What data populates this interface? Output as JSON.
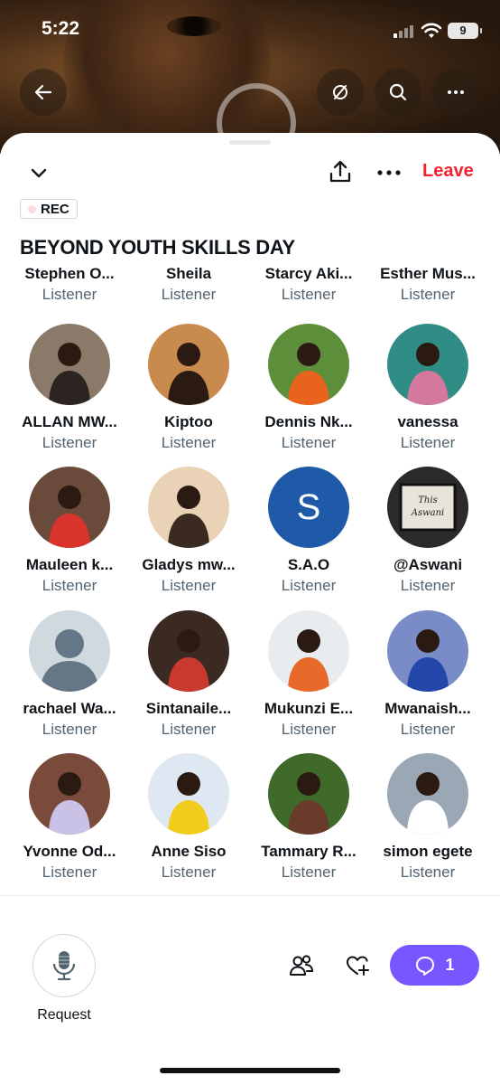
{
  "status_bar": {
    "time": "5:22",
    "battery": "9"
  },
  "sheet": {
    "leave_label": "Leave",
    "rec_label": "REC",
    "space_title": "BEYOND YOUTH SKILLS DAY"
  },
  "participants": [
    {
      "name": "Stephen O...",
      "role": "Listener",
      "avatar": "none"
    },
    {
      "name": "Sheila",
      "role": "Listener",
      "avatar": "none"
    },
    {
      "name": "Starcy Aki...",
      "role": "Listener",
      "avatar": "none"
    },
    {
      "name": "Esther Mus...",
      "role": "Listener",
      "avatar": "none"
    },
    {
      "name": "ALLAN MW...",
      "role": "Listener",
      "avatar": "photo",
      "bg": "#8b7a6a",
      "fg": "#2b2420"
    },
    {
      "name": "Kiptoo",
      "role": "Listener",
      "avatar": "photo",
      "bg": "#c98a4e",
      "fg": "#2a1a12"
    },
    {
      "name": "Dennis Nk...",
      "role": "Listener",
      "avatar": "photo",
      "bg": "#5d8f3a",
      "fg": "#e8641e"
    },
    {
      "name": "vanessa",
      "role": "Listener",
      "avatar": "photo",
      "bg": "#2f8d86",
      "fg": "#d4789e"
    },
    {
      "name": "Mauleen k...",
      "role": "Listener",
      "avatar": "photo",
      "bg": "#6a4a3a",
      "fg": "#d8342c"
    },
    {
      "name": "Gladys mw...",
      "role": "Listener",
      "avatar": "photo",
      "bg": "#e9d2b6",
      "fg": "#3a2a20"
    },
    {
      "name": "S.A.O",
      "role": "Listener",
      "avatar": "letter",
      "letter": "S",
      "bg": "#1e5aa8"
    },
    {
      "name": "@Aswani",
      "role": "Listener",
      "avatar": "sign",
      "bg": "#2a2a2a",
      "sign": "This\nAswani"
    },
    {
      "name": "rachael Wa...",
      "role": "Listener",
      "avatar": "default",
      "bg": "#cfd9de"
    },
    {
      "name": "Sintanaile...",
      "role": "Listener",
      "avatar": "photo",
      "bg": "#3b2a22",
      "fg": "#c8392e"
    },
    {
      "name": "Mukunzi E...",
      "role": "Listener",
      "avatar": "photo",
      "bg": "#e9ecef",
      "fg": "#e86a2a"
    },
    {
      "name": "Mwanaish...",
      "role": "Listener",
      "avatar": "photo",
      "bg": "#7a8cc8",
      "fg": "#2446a8"
    },
    {
      "name": "Yvonne Od...",
      "role": "Listener",
      "avatar": "photo",
      "bg": "#7a4a3a",
      "fg": "#c9c2e6"
    },
    {
      "name": "Anne Siso",
      "role": "Listener",
      "avatar": "photo",
      "bg": "#dfe8f2",
      "fg": "#f2cc1c"
    },
    {
      "name": "Tammary R...",
      "role": "Listener",
      "avatar": "photo",
      "bg": "#3f6a2a",
      "fg": "#6a3a2a"
    },
    {
      "name": "simon egete",
      "role": "Listener",
      "avatar": "photo",
      "bg": "#9aa7b4",
      "fg": "#ffffff"
    }
  ],
  "bottom_bar": {
    "request_label": "Request",
    "comment_count": "1"
  },
  "colors": {
    "accent": "#7856ff",
    "leave": "#f4212e",
    "secondary_text": "#536471"
  },
  "icons": [
    "back-arrow-icon",
    "no-sync-icon",
    "search-icon",
    "more-icon",
    "chevron-down-icon",
    "share-icon",
    "ellipsis-icon",
    "microphone-icon",
    "people-icon",
    "heart-plus-icon",
    "chat-bubble-icon"
  ]
}
